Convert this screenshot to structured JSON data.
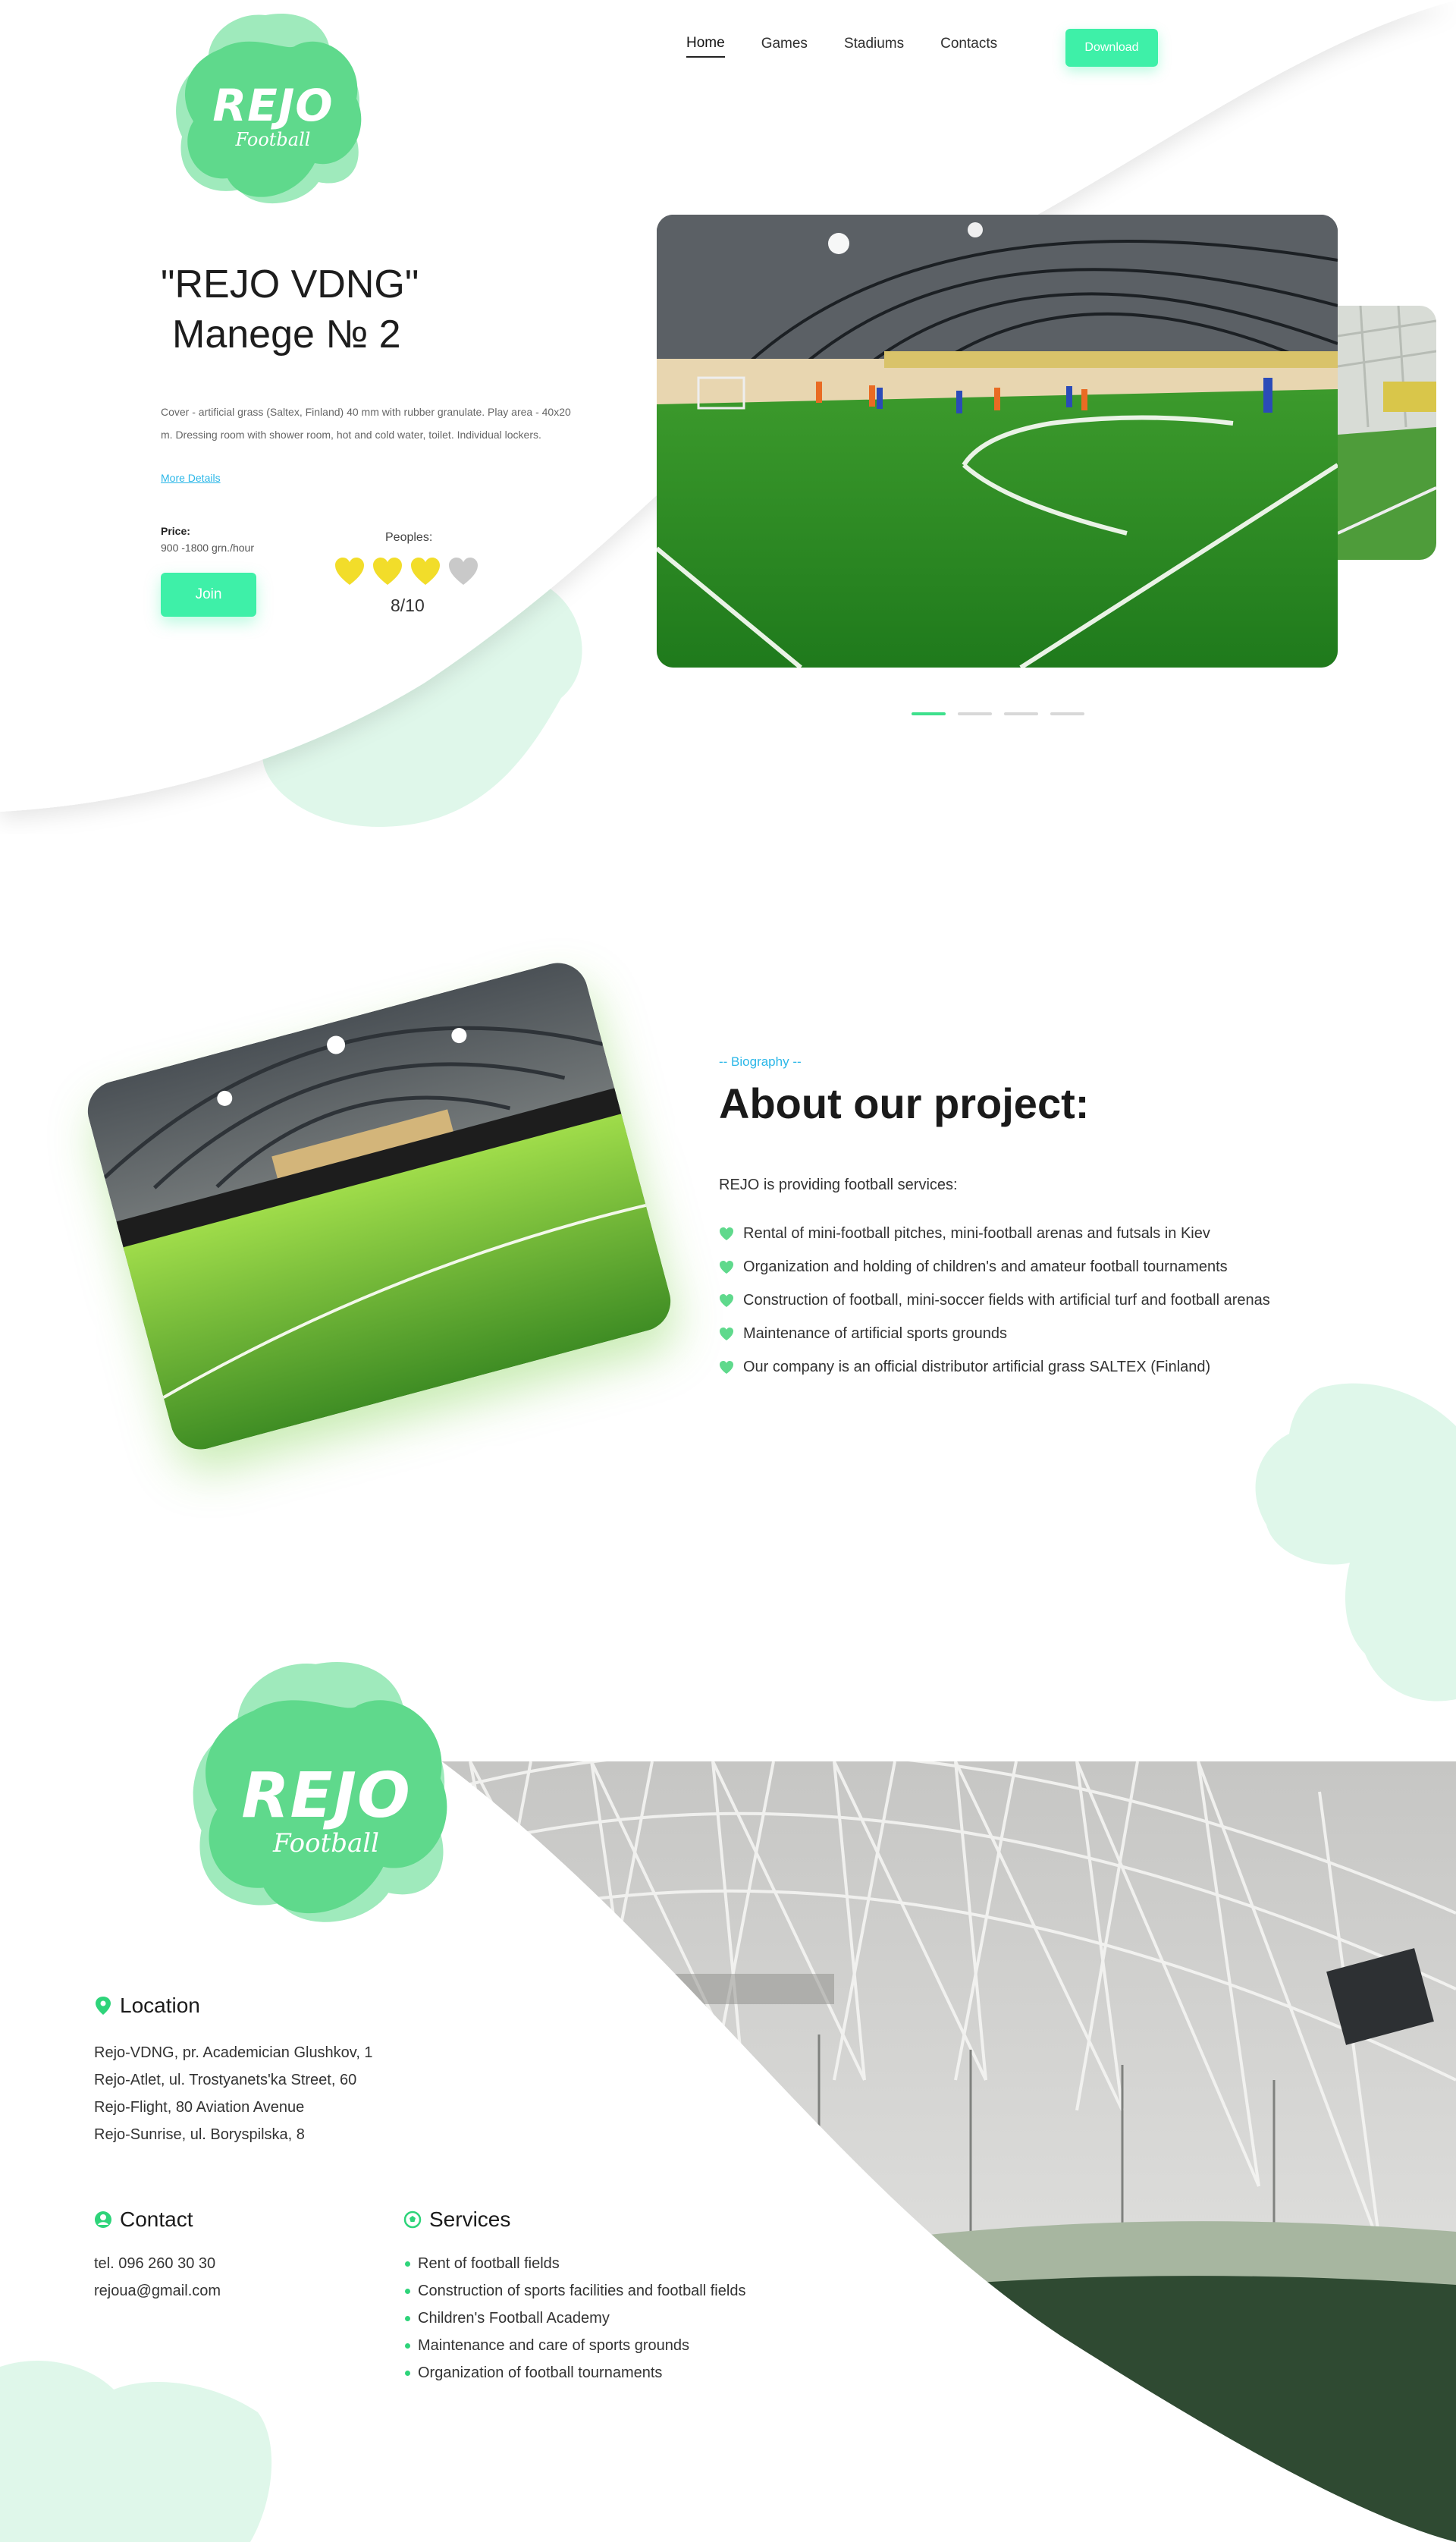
{
  "brand": {
    "name": "REJO",
    "sub": "Football"
  },
  "nav": {
    "items": [
      {
        "label": "Home",
        "active": true
      },
      {
        "label": "Games"
      },
      {
        "label": "Stadiums"
      },
      {
        "label": "Contacts"
      }
    ],
    "download_label": "Download"
  },
  "hero": {
    "title_line1": "\"REJO VDNG\"",
    "title_line2": "Manege № 2",
    "description": "Cover - artificial grass (Saltex, Finland) 40 mm with rubber granulate. Play area - 40x20 m. Dressing room with shower room, hot and cold water, toilet. Individual lockers.",
    "more_link": "More Details",
    "price_label": "Price:",
    "price_value": "900 -1800 grn./hour",
    "join_label": "Join",
    "peoples_label": "Peoples:",
    "peoples_count": "8/10",
    "hearts_filled": 3,
    "hearts_total": 4,
    "slides_total": 4,
    "active_slide": 1
  },
  "about": {
    "label": "-- Biography --",
    "title": "About our project:",
    "intro": "REJO is providing football services:",
    "items": [
      "Rental of mini-football pitches, mini-football arenas and futsals in Kiev",
      "Organization and holding of children's and amateur football tournaments",
      "Construction of football, mini-soccer fields with artificial turf and football arenas",
      "Maintenance of artificial sports grounds",
      "Our company is an official distributor artificial grass SALTEX (Finland)"
    ]
  },
  "footer": {
    "location": {
      "title": "Location",
      "lines": [
        "Rejo-VDNG, pr. Academician Glushkov, 1",
        "Rejo-Atlet, ul. Trostyanets'ka Street, 60",
        "Rejo-Flight, 80 Aviation Avenue",
        "Rejo-Sunrise, ul. Boryspilska, 8"
      ]
    },
    "contact": {
      "title": "Contact",
      "phone": "tel. 096 260 30 30",
      "email": "rejoua@gmail.com"
    },
    "services": {
      "title": "Services",
      "items": [
        "Rent of football fields",
        "Construction of sports facilities and football fields",
        "Children's Football Academy",
        "Maintenance and care of sports grounds",
        "Organization of football tournaments"
      ]
    }
  },
  "colors": {
    "accent": "#3ef0a8",
    "brand_green": "#5fd98c",
    "blob_light": "#dff7ea",
    "link": "#2bb7e8",
    "heart_filled": "#f2dd2a",
    "heart_empty": "#c9c9c9"
  }
}
